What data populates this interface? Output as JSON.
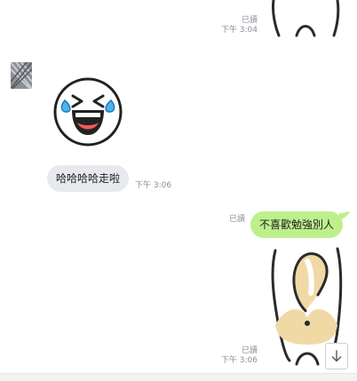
{
  "messages": [
    {
      "read": "已讀",
      "time": "下午 3:04"
    },
    {
      "time": "下午 3:06",
      "text": "哈哈哈哈走啦"
    },
    {
      "read": "已讀",
      "text": "不喜歡勉強別人"
    },
    {
      "read": "已讀",
      "time": "下午 3:06"
    }
  ],
  "colors": {
    "outgoing_bubble": "#bdf08c",
    "incoming_bubble": "#e7e9ee",
    "meta_text": "#8a8f99"
  },
  "icons": {
    "avatar": "avatar-thumbnail",
    "sticker_laugh": "laughing-crying-face-sticker",
    "sticker_cat": "cat-back-sticker",
    "scroll": "arrow-down-icon"
  }
}
